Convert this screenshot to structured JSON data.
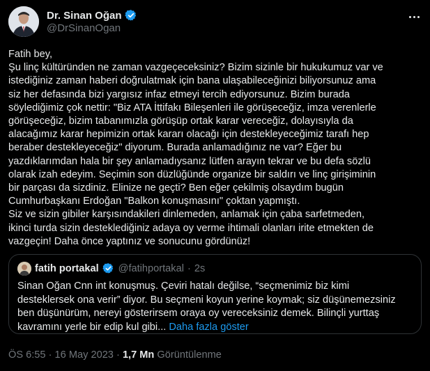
{
  "author": {
    "name": "Dr. Sinan Oğan",
    "handle": "@DrSinanOgan"
  },
  "tweet": {
    "lines": [
      "Fatih bey,",
      "Şu linç kültüründen ne zaman vazgeçeceksiniz? Bizim sizinle bir hukukumuz var ve",
      "istediğiniz zaman haberi doğrulatmak için bana ulaşabileceğinizi biliyorsunuz ama",
      "siz her defasında bizi yargısız infaz etmeyi tercih ediyorsunuz. Bizim burada",
      "söylediğimiz çok nettir: \"Biz ATA İttifakı Bileşenleri ile görüşeceğiz, imza verenlerle",
      "görüşeceğiz, bizim tabanımızla görüşüp ortak karar vereceğiz, dolayısıyla da",
      "alacağımız karar hepimizin ortak kararı olacağı için destekleyeceğimiz tarafı hep",
      "beraber destekleyeceğiz\" diyorum. Burada anlamadığınız ne var? Eğer bu",
      "yazdıklarımdan hala bir şey anlamadıysanız lütfen arayın tekrar ve bu defa sözlü",
      "olarak izah edeyim. Seçimin son düzlüğünde organize bir saldırı ve linç girişiminin",
      "bir parçası da sizdiniz. Elinize ne geçti? Ben eğer çekilmiş olsaydım bugün",
      "Cumhurbaşkanı Erdoğan \"Balkon konuşmasını\" çoktan yapmıştı.",
      "Siz ve sizin gibiler karşısındakileri dinlemeden, anlamak için çaba sarfetmeden,",
      "ikinci turda sizin desteklediğiniz adaya oy verme ihtimali olanları irite etmekten de",
      "vazgeçin! Daha önce yaptınız ve sonucunu gördünüz!"
    ]
  },
  "quote": {
    "name": "fatih portakal",
    "handle": "@fatihportakal",
    "separator": "·",
    "time": "2s",
    "lines": [
      "Sinan Oğan Cnn int konuşmuş. Çeviri hatalı değilse, “seçmenimiz biz kimi",
      "desteklersek ona verir” diyor. Bu seçmeni koyun yerine koymak; siz düşünemezsiniz",
      "ben düşünürüm, nereyi gösterirsem oraya oy vereceksiniz demek. Bilinçli yurttaş"
    ],
    "last_line": "kavramını yerle bir edip kul gibi...",
    "show_more": "Daha fazla göster"
  },
  "footer": {
    "time": "ÖS 6:55",
    "separator": "·",
    "date": "16 May 2023",
    "views_count": "1,7 Mn",
    "views_label": "Görüntülenme"
  },
  "icons": {
    "verified": "verified-badge-icon",
    "more": "more-options-icon"
  },
  "colors": {
    "background": "#000000",
    "text": "#e7e9ea",
    "secondary": "#71767b",
    "accent": "#1d9bf0",
    "border": "#2f3336"
  }
}
